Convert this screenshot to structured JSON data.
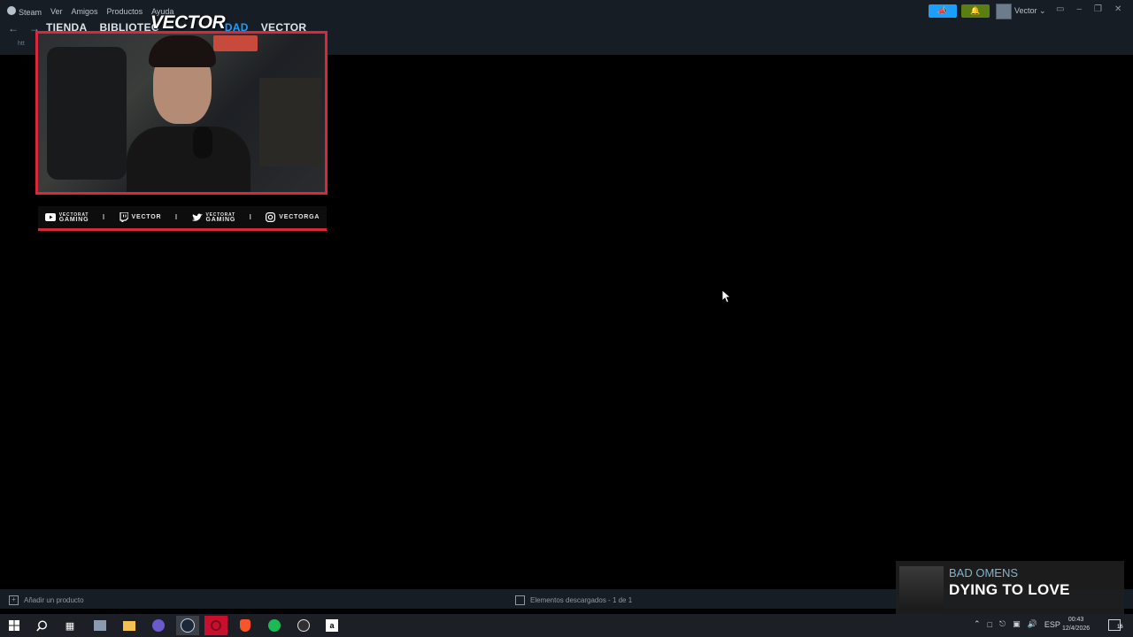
{
  "steam": {
    "menu": [
      "Steam",
      "Ver",
      "Amigos",
      "Productos",
      "Ayuda"
    ],
    "tabs": [
      "TIENDA",
      "BIBLIOTEC",
      "DAD",
      "VECTOR"
    ],
    "url_text": "htt",
    "user_name": "Vector",
    "announce_icon": "megaphone-icon",
    "notif_icon": "bell-icon"
  },
  "overlay": {
    "cam_logo": "VECTOR",
    "social": {
      "youtube_top": "VECTORAT",
      "youtube_bottom": "GAMING",
      "twitch": "VECTOR",
      "twitter_top": "VECTORAT",
      "twitter_bottom": "GAMING",
      "instagram": "VECTORGA"
    }
  },
  "statusbar": {
    "add_product": "Añadir un producto",
    "downloads": "Elementos descargados - 1 de 1"
  },
  "song": {
    "artist": "BAD OMENS",
    "title": "DYING TO LOVE"
  },
  "taskbar": {
    "language": "ESP",
    "time": "00:43",
    "date": "12/4/2026",
    "notification_count": "16"
  },
  "colors": {
    "steam_bg": "#171d25",
    "accent_blue": "#1a9fff",
    "notif_green": "#5c7e10",
    "overlay_red": "#d9283c"
  }
}
